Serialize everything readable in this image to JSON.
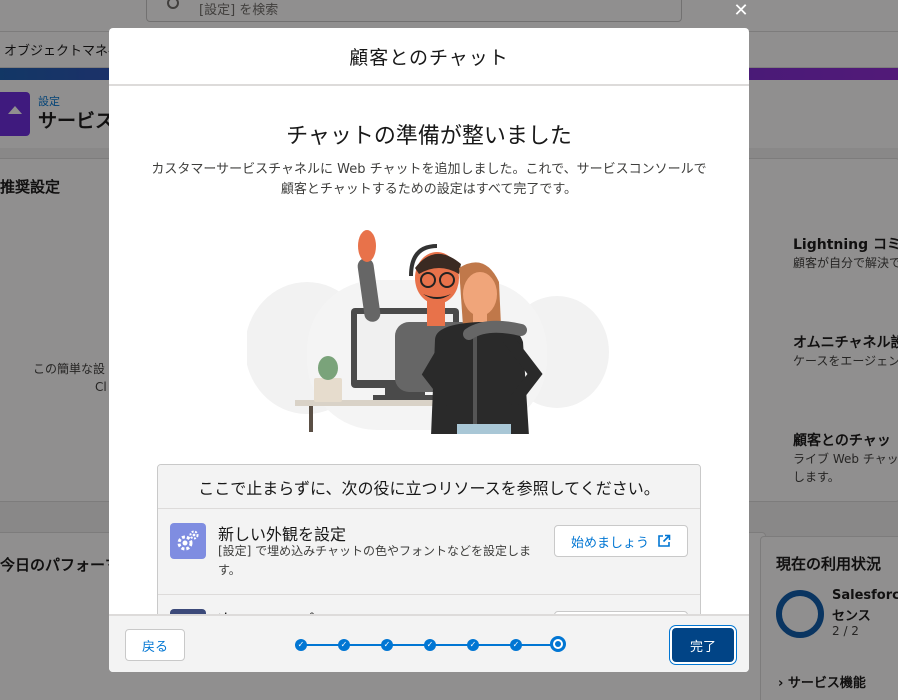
{
  "background": {
    "search_placeholder": "[設定] を検索",
    "nav_label": "オブジェクトマネ-",
    "breadcrumb": "設定",
    "page_title": "サービス",
    "section_title": "推奨設定",
    "left_text_1": "この簡単な設",
    "left_text_2": "Cl",
    "perf_title": "今日のパフォーマ",
    "usage_title": "現在の利用状況",
    "usage_label_1": "Salesforce",
    "usage_label_2": "センス",
    "usage_count": "2 / 2",
    "usage_link": "サービス機能",
    "cards": [
      {
        "title": "Lightning コミュ",
        "desc": "顧客が自分で解決で"
      },
      {
        "title": "オムニチャネル設",
        "desc": "ケースをエージェン"
      },
      {
        "title": "顧客とのチャッ",
        "desc": "ライブ Web チャッ",
        "desc2": "します。"
      }
    ]
  },
  "modal": {
    "header": "顧客とのチャット",
    "title": "チャットの準備が整いました",
    "description": "カスタマーサービスチャネルに Web チャットを追加しました。これで、サービスコンソールで顧客とチャットするための設定はすべて完了です。",
    "resources": {
      "heading": "ここで止まらずに、次の役に立つリソースを参照してください。",
      "items": [
        {
          "name": "新しい外観を設定",
          "description": "[設定] で埋め込みチャットの色やフォントなどを設定します。",
          "button": "始めましょう",
          "icon": "gears-icon"
        },
        {
          "name": "次のステップ",
          "description": "",
          "button": "",
          "icon": "doc-icon"
        }
      ]
    },
    "footer": {
      "back_label": "戻る",
      "done_label": "完了",
      "progress": {
        "total_steps": 7,
        "current_step": 7
      }
    },
    "close_icon": "close-icon"
  },
  "colors": {
    "brand": "#0176d3",
    "primary_button": "#014486",
    "resource_icon": "#7f8de1"
  }
}
